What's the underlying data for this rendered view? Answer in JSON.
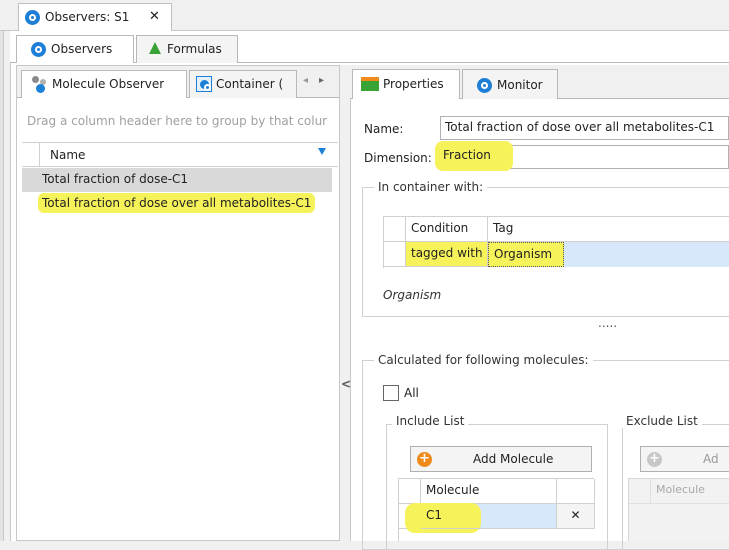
{
  "document_tab": {
    "title": "Observers: S1",
    "close": "✕"
  },
  "outer_tabs": [
    {
      "label": "Observers"
    },
    {
      "label": "Formulas"
    }
  ],
  "left": {
    "tabs": [
      {
        "label": "Molecule Observer"
      },
      {
        "label": "Container ("
      }
    ],
    "tab_nav": {
      "prev": "◂",
      "next": "▸"
    },
    "group_hint": "Drag a column header here to group by that colur",
    "grid": {
      "column_header": "Name",
      "rows": [
        "Total fraction of dose-C1",
        "Total fraction of dose over all metabolites-C1"
      ]
    }
  },
  "splitter": {
    "glyph": "<"
  },
  "right": {
    "tabs": [
      {
        "label": "Properties"
      },
      {
        "label": "Monitor"
      }
    ],
    "name_label": "Name:",
    "name_value": "Total fraction of dose over all metabolites-C1",
    "dimension_label": "Dimension:",
    "dimension_value": "Fraction",
    "container_group": {
      "title": "In container with:",
      "columns": [
        "Condition",
        "Tag"
      ],
      "rows": [
        {
          "condition": "tagged with",
          "tag": "Organism"
        }
      ],
      "summary": "Organism"
    },
    "collapse_dots": ".....",
    "molecules_group": {
      "title": "Calculated for following molecules:",
      "all_label": "All",
      "include": {
        "title": "Include List",
        "add_button": "Add Molecule",
        "column": "Molecule",
        "rows": [
          "C1"
        ],
        "remove": "✕"
      },
      "exclude": {
        "title": "Exclude List",
        "add_button": "Ad",
        "column": "Molecule"
      }
    }
  },
  "colors": {
    "highlight": "#f6f25a",
    "eye_blue": "#1d7fd6",
    "add_orange": "#f08a1b",
    "flask_green": "#3aa336",
    "selected_row": "#d6e8fa"
  }
}
